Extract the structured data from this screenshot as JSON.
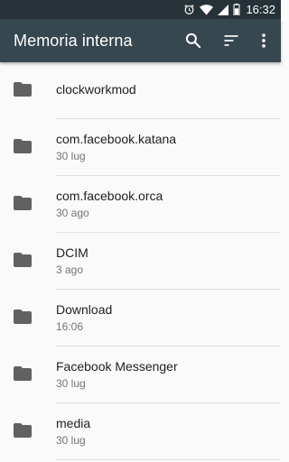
{
  "status_bar": {
    "time": "16:32",
    "icons": [
      "alarm-icon",
      "wifi-icon",
      "signal-icon",
      "battery-icon"
    ]
  },
  "app_bar": {
    "title": "Memoria interna",
    "actions": [
      "search-icon",
      "sort-icon",
      "more-vert-icon"
    ]
  },
  "colors": {
    "status_bar": "#263238",
    "app_bar": "#37474f",
    "background": "#fafafa",
    "folder_icon": "#616161",
    "primary_text": "#212121",
    "secondary_text": "#757575"
  },
  "files": [
    {
      "name": "clockworkmod",
      "date": ""
    },
    {
      "name": "com.facebook.katana",
      "date": "30 lug"
    },
    {
      "name": "com.facebook.orca",
      "date": "30 ago"
    },
    {
      "name": "DCIM",
      "date": "3 ago"
    },
    {
      "name": "Download",
      "date": "16:06"
    },
    {
      "name": "Facebook Messenger",
      "date": "30 lug"
    },
    {
      "name": "media",
      "date": "30 lug"
    }
  ]
}
